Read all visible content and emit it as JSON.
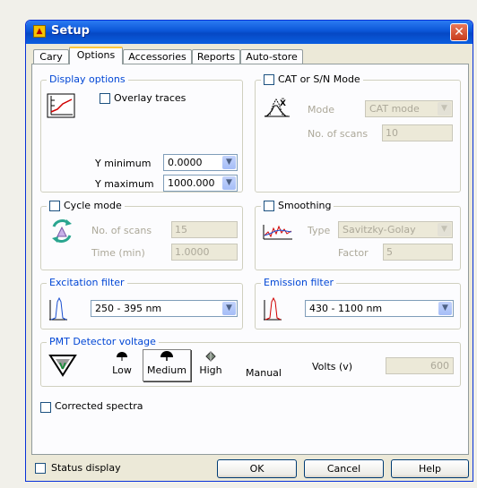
{
  "window": {
    "title": "Setup",
    "close_glyph": "✕"
  },
  "tabs": [
    {
      "label": "Cary",
      "active": false
    },
    {
      "label": "Options",
      "active": true
    },
    {
      "label": "Accessories",
      "active": false
    },
    {
      "label": "Reports",
      "active": false
    },
    {
      "label": "Auto-store",
      "active": false
    }
  ],
  "display_options": {
    "title": "Display options",
    "overlay_label": "Overlay traces",
    "overlay_checked": false,
    "ymin_label": "Y minimum",
    "ymin_value": "0.0000",
    "ymax_label": "Y maximum",
    "ymax_value": "1000.000"
  },
  "cat_mode": {
    "title": "CAT or S/N Mode",
    "checked": false,
    "mode_label": "Mode",
    "mode_value": "CAT mode",
    "scans_label": "No. of scans",
    "scans_value": "10"
  },
  "cycle_mode": {
    "title": "Cycle mode",
    "checked": false,
    "scans_label": "No. of scans",
    "scans_value": "15",
    "time_label": "Time (min)",
    "time_value": "1.0000"
  },
  "smoothing": {
    "title": "Smoothing",
    "checked": false,
    "type_label": "Type",
    "type_value": "Savitzky-Golay",
    "factor_label": "Factor",
    "factor_value": "5"
  },
  "excitation_filter": {
    "title": "Excitation filter",
    "value": "250 - 395 nm"
  },
  "emission_filter": {
    "title": "Emission filter",
    "value": "430 - 1100 nm"
  },
  "pmt": {
    "title": "PMT Detector voltage",
    "low_label": "Low",
    "medium_label": "Medium",
    "high_label": "High",
    "manual_label": "Manual",
    "selected": "Medium",
    "volts_label": "Volts (v)",
    "volts_value": "600"
  },
  "corrected_spectra": {
    "label": "Corrected spectra",
    "checked": false
  },
  "footer": {
    "status_label": "Status display",
    "ok_label": "OK",
    "cancel_label": "Cancel",
    "help_label": "Help"
  },
  "colors": {
    "titlebar": "#0a55d7",
    "group_label": "#0046d5",
    "disabled_text": "#aca899",
    "tab_highlight": "#ffc83c"
  }
}
